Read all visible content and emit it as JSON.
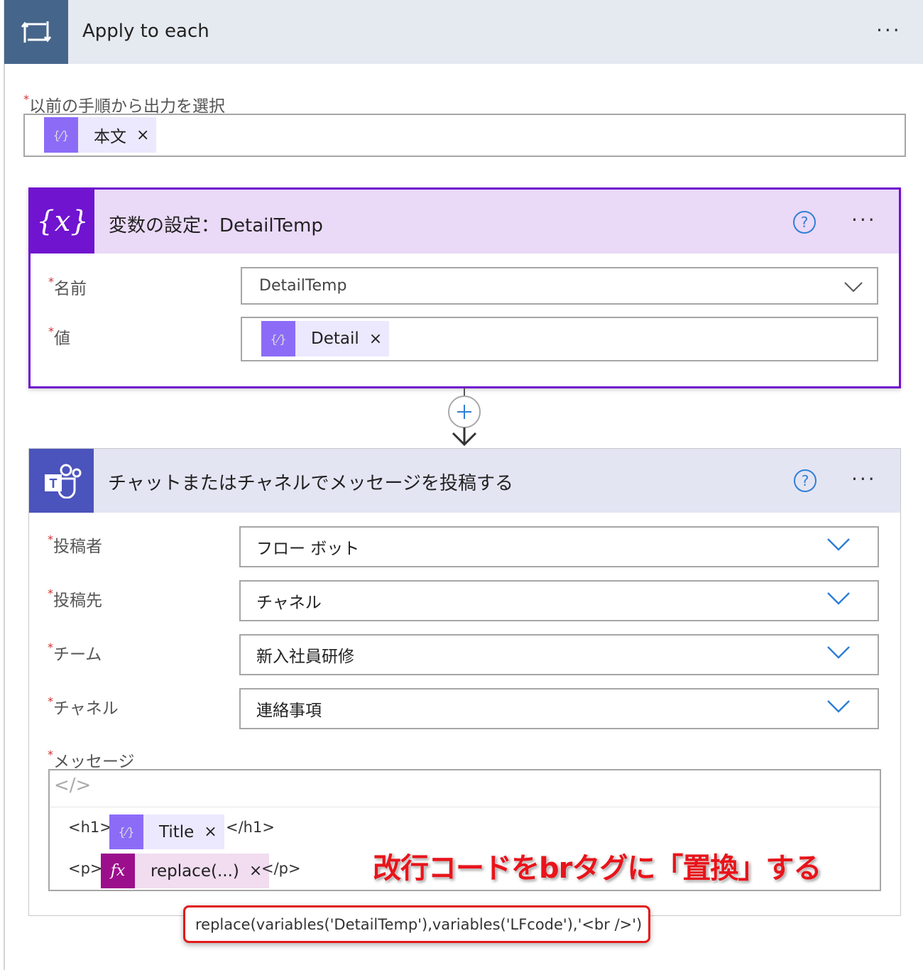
{
  "apply_each": {
    "title": "Apply to each",
    "more": "···",
    "select_label": "以前の手順から出力を選択",
    "token": "本文"
  },
  "set_var": {
    "title": "変数の設定：DetailTemp",
    "help": "?",
    "more": "···",
    "name_label": "名前",
    "name_value": "DetailTemp",
    "value_label": "値",
    "value_token": "Detail"
  },
  "teams": {
    "title": "チャットまたはチャネルでメッセージを投稿する",
    "help": "?",
    "more": "···",
    "fields": [
      {
        "label": "投稿者",
        "value": "フロー ボット"
      },
      {
        "label": "投稿先",
        "value": "チャネル"
      },
      {
        "label": "チーム",
        "value": "新入社員研修"
      },
      {
        "label": "チャネル",
        "value": "連絡事項"
      }
    ],
    "message_label": "メッセージ",
    "code_toggle": "</>",
    "h1_open": "<h1>",
    "h1_token": "Title",
    "h1_close": "</h1>",
    "p_open": "<p>",
    "p_token": "replace(...)",
    "p_close": "</p>",
    "fx": "fx"
  },
  "required": "*",
  "remove": "×",
  "annotation": "改行コードをbrタグに「置換」する",
  "tooltip": "replace(variables('DetailTemp'),variables('LFcode'),'<br />')",
  "colors": {
    "loop": "#46658a",
    "variable": "#7014d0",
    "teams": "#4b53bc",
    "annotation": "#e8141b"
  }
}
